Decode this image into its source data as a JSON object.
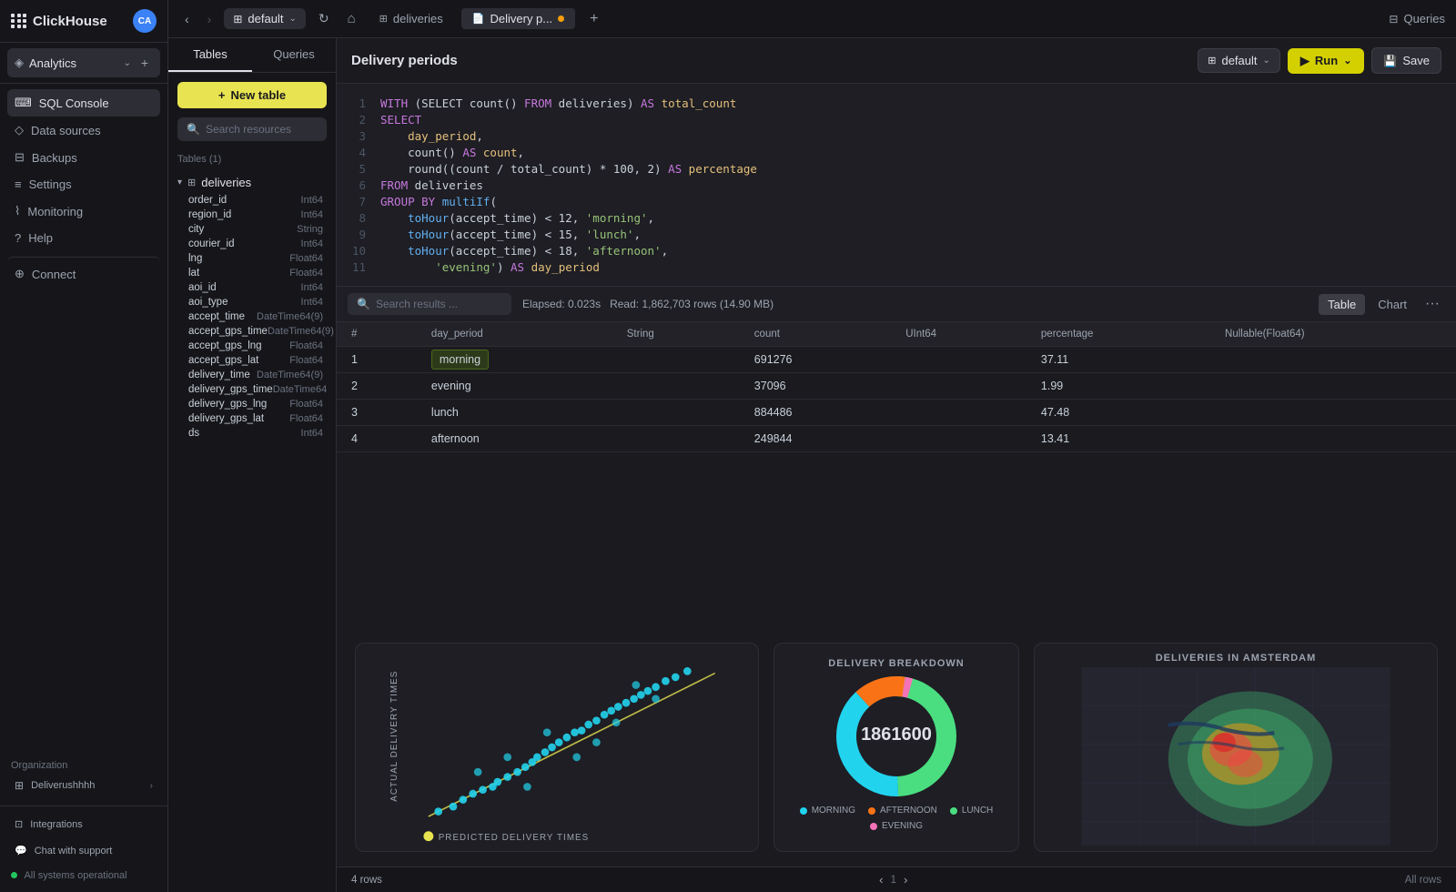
{
  "app": {
    "name": "ClickHouse",
    "avatar": "CA"
  },
  "sidebar": {
    "analytics_label": "Analytics",
    "items": [
      {
        "id": "sql-console",
        "label": "SQL Console",
        "icon": "terminal"
      },
      {
        "id": "data-sources",
        "label": "Data sources",
        "icon": "database"
      },
      {
        "id": "backups",
        "label": "Backups",
        "icon": "archive"
      },
      {
        "id": "settings",
        "label": "Settings",
        "icon": "settings"
      },
      {
        "id": "monitoring",
        "label": "Monitoring",
        "icon": "chart"
      },
      {
        "id": "help",
        "label": "Help",
        "icon": "help"
      },
      {
        "id": "connect",
        "label": "Connect",
        "icon": "connect"
      }
    ],
    "org_label": "Organization",
    "org_name": "Deliverushhhh",
    "integrations": "Integrations",
    "chat_support": "Chat with support",
    "all_systems": "All systems operational"
  },
  "topbar": {
    "db_name": "default",
    "tabs": [
      {
        "id": "deliveries",
        "label": "deliveries",
        "icon": "table",
        "active": false
      },
      {
        "id": "delivery-p",
        "label": "Delivery p...",
        "icon": "query",
        "active": true,
        "modified": true
      }
    ],
    "queries_label": "Queries",
    "refresh_icon": "↻"
  },
  "tables_panel": {
    "tabs": [
      "Tables",
      "Queries"
    ],
    "active_tab": "Tables",
    "new_table_label": "New table",
    "search_placeholder": "Search resources",
    "tables_count": "Tables (1)",
    "table_group": "deliveries",
    "fields": [
      {
        "name": "order_id",
        "type": "Int64"
      },
      {
        "name": "region_id",
        "type": "Int64"
      },
      {
        "name": "city",
        "type": "String"
      },
      {
        "name": "courier_id",
        "type": "Int64"
      },
      {
        "name": "lng",
        "type": "Float64"
      },
      {
        "name": "lat",
        "type": "Float64"
      },
      {
        "name": "aoi_id",
        "type": "Int64"
      },
      {
        "name": "aoi_type",
        "type": "Int64"
      },
      {
        "name": "accept_time",
        "type": "DateTime64(9)"
      },
      {
        "name": "accept_gps_time",
        "type": "DateTime64(9)"
      },
      {
        "name": "accept_gps_lng",
        "type": "Float64"
      },
      {
        "name": "accept_gps_lat",
        "type": "Float64"
      },
      {
        "name": "delivery_time",
        "type": "DateTime64(9)"
      },
      {
        "name": "delivery_gps_time",
        "type": "DateTime64"
      },
      {
        "name": "delivery_gps_lng",
        "type": "Float64"
      },
      {
        "name": "delivery_gps_lat",
        "type": "Float64"
      },
      {
        "name": "ds",
        "type": "Int64"
      }
    ]
  },
  "query": {
    "title": "Delivery periods",
    "db_selector": "default",
    "run_label": "Run",
    "save_label": "Save",
    "code_lines": [
      {
        "num": 1,
        "text": "WITH (SELECT count() FROM deliveries) AS total_count"
      },
      {
        "num": 2,
        "text": "SELECT"
      },
      {
        "num": 3,
        "text": "    day_period,"
      },
      {
        "num": 4,
        "text": "    count() AS count,"
      },
      {
        "num": 5,
        "text": "    round((count / total_count) * 100, 2) AS percentage"
      },
      {
        "num": 6,
        "text": "FROM deliveries"
      },
      {
        "num": 7,
        "text": "GROUP BY multiIf("
      },
      {
        "num": 8,
        "text": "    toHour(accept_time) < 12, 'morning',"
      },
      {
        "num": 9,
        "text": "    toHour(accept_time) < 15, 'lunch',"
      },
      {
        "num": 10,
        "text": "    toHour(accept_time) < 18, 'afternoon',"
      },
      {
        "num": 11,
        "text": "        'evening') AS day_period"
      }
    ]
  },
  "results": {
    "search_placeholder": "Search results ...",
    "elapsed": "Elapsed: 0.023s",
    "read_info": "Read: 1,862,703 rows (14.90 MB)",
    "view_table": "Table",
    "view_chart": "Chart",
    "columns": [
      "#",
      "day_period",
      "String",
      "count",
      "UInt64",
      "percentage",
      "Nullable(Float64)"
    ],
    "rows": [
      {
        "num": 1,
        "period": "morning",
        "count": "691276",
        "percentage": "37.11",
        "highlighted": true
      },
      {
        "num": 2,
        "period": "evening",
        "count": "37096",
        "percentage": "1.99",
        "highlighted": false
      },
      {
        "num": 3,
        "period": "lunch",
        "count": "884486",
        "percentage": "47.48",
        "highlighted": false
      },
      {
        "num": 4,
        "period": "afternoon",
        "count": "249844",
        "percentage": "13.41",
        "highlighted": false
      }
    ],
    "row_count": "4 rows",
    "page": "1",
    "all_rows": "All rows"
  },
  "charts": {
    "scatter": {
      "title": "PREDICTED DELIVERY TIMES",
      "y_label": "ACTUAL DELIVERY TIMES"
    },
    "donut": {
      "title": "DELIVERY BREAKDOWN",
      "center_value": "1861600",
      "segments": [
        {
          "label": "MORNING",
          "color": "#22d3ee",
          "percent": 37.11
        },
        {
          "label": "LUNCH",
          "color": "#4ade80",
          "percent": 47.48
        },
        {
          "label": "AFTERNOON",
          "color": "#f97316",
          "percent": 13.41
        },
        {
          "label": "EVENING",
          "color": "#f472b6",
          "percent": 1.99
        }
      ]
    },
    "map": {
      "title": "DELIVERIES IN AMSTERDAM"
    }
  },
  "colors": {
    "accent_yellow": "#e8e350",
    "run_yellow": "#d4d000",
    "active_border": "#e0e0e8",
    "morning_highlight": "#2d3a1a"
  }
}
